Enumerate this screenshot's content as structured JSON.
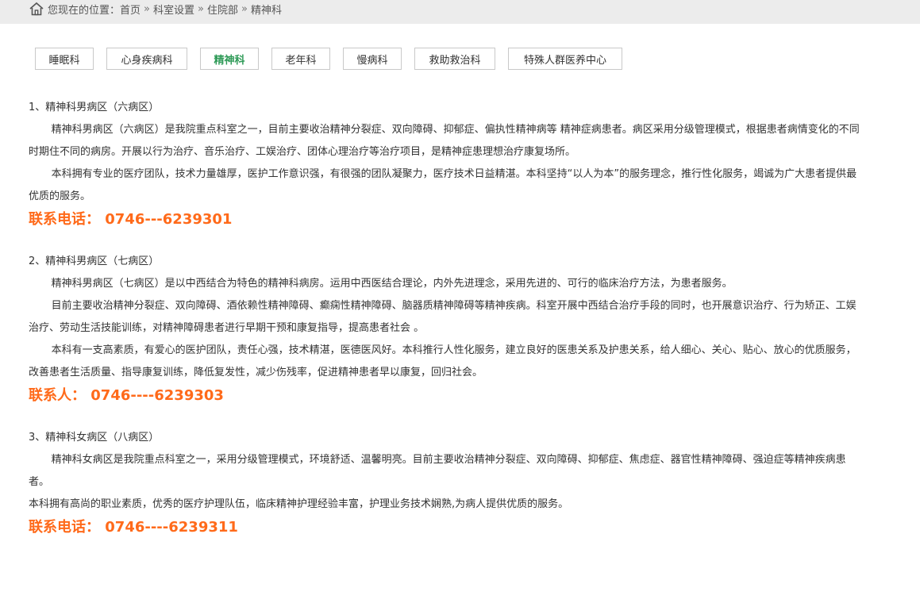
{
  "breadcrumb": {
    "prefix": "您现在的位置：",
    "items": [
      "首页",
      "科室设置",
      "住院部",
      "精神科"
    ],
    "separator": "»"
  },
  "tabs": [
    {
      "label": "睡眠科",
      "active": false
    },
    {
      "label": "心身疾病科",
      "active": false
    },
    {
      "label": "精神科",
      "active": true
    },
    {
      "label": "老年科",
      "active": false
    },
    {
      "label": "慢病科",
      "active": false
    },
    {
      "label": "救助救治科",
      "active": false
    },
    {
      "label": "特殊人群医养中心",
      "active": false
    }
  ],
  "sections": [
    {
      "title": "1、精神科男病区（六病区）",
      "paragraphs": [
        "精神科男病区（六病区）是我院重点科室之一，目前主要收治精神分裂症、双向障碍、抑郁症、偏执性精神病等 精神症病患者。病区采用分级管理模式，根据患者病情变化的不同时期住不同的病房。开展以行为治疗、音乐治疗、工娱治疗、团体心理治疗等治疗项目，是精神症患理想治疗康复场所。",
        "本科拥有专业的医疗团队，技术力量雄厚，医护工作意识强，有很强的团队凝聚力，医疗技术日益精湛。本科坚持“以人为本”的服务理念，推行性化服务，竭诚为广大患者提供最优质的服务。"
      ],
      "contact": "联系电话：  0746---6239301"
    },
    {
      "title": "2、精神科男病区（七病区）",
      "paragraphs": [
        "精神科男病区（七病区）是以中西结合为特色的精神科病房。运用中西医结合理论，内外先进理念，采用先进的、可行的临床治疗方法，为患者服务。",
        "目前主要收治精神分裂症、双向障碍、酒依赖性精神障碍、癫痫性精神障碍、脑器质精神障碍等精神疾病。科室开展中西结合治疗手段的同时，也开展意识治疗、行为矫正、工娱治疗、劳动生活技能训练，对精神障碍患者进行早期干预和康复指导，提高患者社会  。",
        "本科有一支高素质，有爱心的医护团队，责任心强，技术精湛，医德医风好。本科推行人性化服务，建立良好的医患关系及护患关系，给人细心、关心、贴心、放心的优质服务，改善患者生活质量、指导康复训练，降低复发性，减少伤残率，促进精神患者早以康复，回归社会。"
      ],
      "contact": "联系人：  0746----6239303"
    },
    {
      "title": "3、精神科女病区（八病区）",
      "paragraphs": [
        "精神科女病区是我院重点科室之一，采用分级管理模式，环境舒适、温馨明亮。目前主要收治精神分裂症、双向障碍、抑郁症、焦虑症、器官性精神障碍、强迫症等精神疾病患者。"
      ],
      "plain_paragraph": "本科拥有高尚的职业素质，优秀的医疗护理队伍，临床精神护理经验丰富，护理业务技术娴熟,为病人提供优质的服务。",
      "contact": "联系电话：  0746----6239311"
    }
  ],
  "colors": {
    "topbar_bg": "#ececec",
    "active_tab": "#2e9a57",
    "contact": "#ff6a1a",
    "text": "#333333"
  }
}
